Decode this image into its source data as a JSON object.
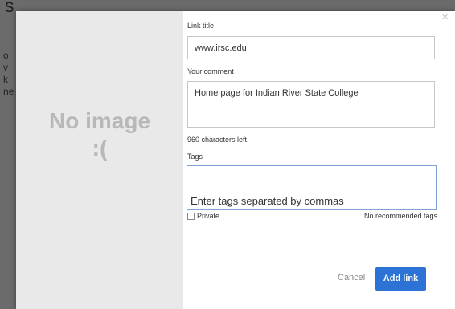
{
  "background": {
    "heading_fragment": "s",
    "side_text": [
      "o",
      "v",
      "k",
      "ne"
    ]
  },
  "dialog": {
    "preview": {
      "line1": "No image",
      "line2": ":("
    },
    "close_glyph": "×",
    "link_title": {
      "label": "Link title",
      "value": "www.irsc.edu"
    },
    "comment": {
      "label": "Your comment",
      "value": "Home page for Indian River State College"
    },
    "chars_left": "960 characters left.",
    "tags": {
      "label": "Tags",
      "placeholder": "Enter tags separated by commas"
    },
    "private_label": "Private",
    "no_recommended": "No recommended tags",
    "cancel_label": "Cancel",
    "add_label": "Add link"
  },
  "colors": {
    "accent": "#2d73d6",
    "focus_border": "#7fa3d4",
    "preview_bg": "#e9e9e9"
  },
  "icons": {
    "close": "close-icon"
  }
}
